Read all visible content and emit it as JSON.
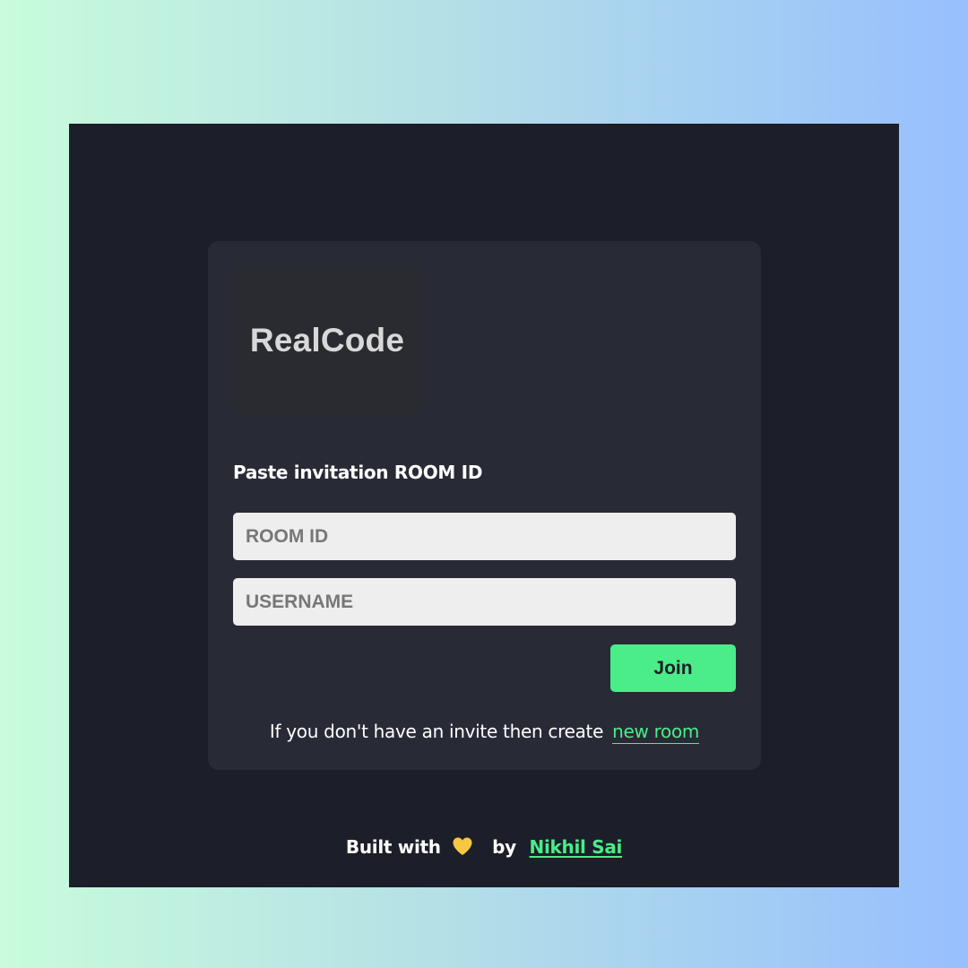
{
  "app": {
    "logo_text": "RealCode"
  },
  "form": {
    "heading": "Paste invitation ROOM ID",
    "room_id": {
      "value": "",
      "placeholder": "ROOM ID"
    },
    "username": {
      "value": "",
      "placeholder": "USERNAME"
    },
    "join_label": "Join",
    "invite_text": "If you don't have an invite then create",
    "new_room_link": "new room"
  },
  "footer": {
    "built_with": "Built with",
    "heart_icon": "yellow-heart-icon",
    "by": "by",
    "author": "Nikhil Sai"
  },
  "colors": {
    "accent": "#4aed88",
    "window_bg": "#1c1e29",
    "card_bg": "#282a36",
    "heart": "#f5c842"
  }
}
